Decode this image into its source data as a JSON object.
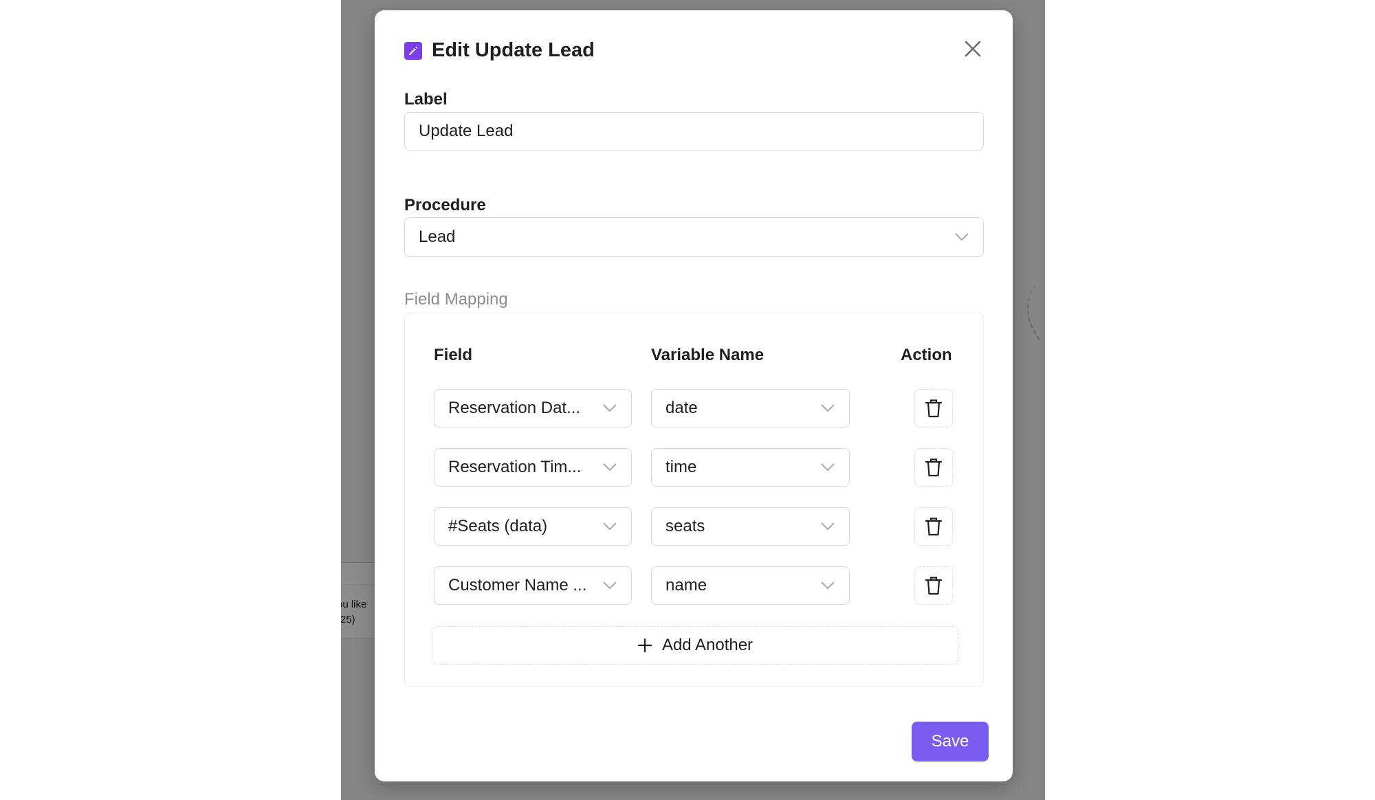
{
  "background": {
    "node_text_line1": "ou like",
    "node_text_line2": ")25)"
  },
  "dialog": {
    "title": "Edit Update Lead",
    "title_icon": "edit-icon",
    "accent_color": "#7b3fe4",
    "label_heading": "Label",
    "label_value": "Update Lead",
    "procedure_heading": "Procedure",
    "procedure_value": "Lead",
    "field_mapping_heading": "Field Mapping",
    "columns": {
      "field": "Field",
      "variable_name": "Variable Name",
      "action": "Action"
    },
    "rows": [
      {
        "field": "Reservation Dat...",
        "variable": "date"
      },
      {
        "field": "Reservation Tim...",
        "variable": "time"
      },
      {
        "field": "#Seats (data)",
        "variable": "seats"
      },
      {
        "field": "Customer Name ...",
        "variable": "name"
      }
    ],
    "add_another_label": "Add Another",
    "save_label": "Save",
    "save_color": "#7a5cf0"
  }
}
